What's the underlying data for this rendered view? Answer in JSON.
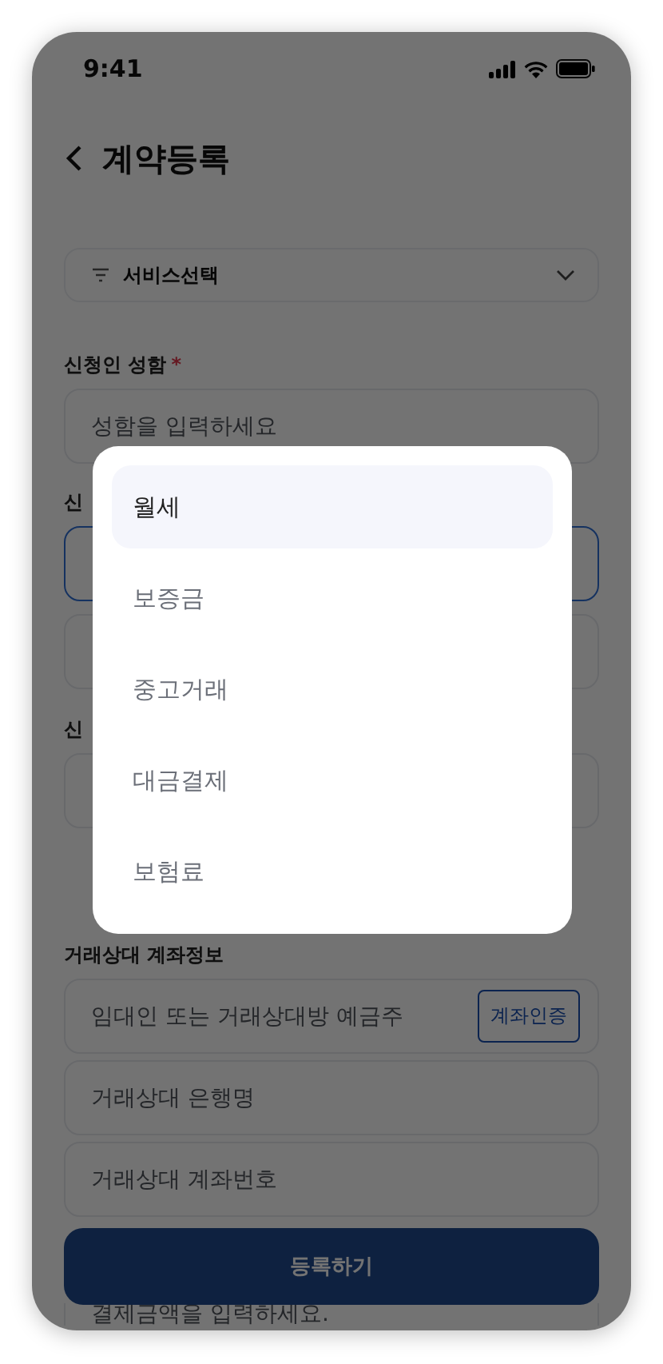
{
  "status_bar": {
    "time": "9:41"
  },
  "header": {
    "title": "계약등록"
  },
  "service_select": {
    "label": "서비스선택"
  },
  "sections": [
    {
      "label": "신청인 성함",
      "required_mark": "*",
      "fields": [
        {
          "placeholder": "성함을 입력하세요",
          "focused": false
        }
      ]
    },
    {
      "label": "신",
      "fields": [
        {
          "focused": true
        },
        {
          "focused": false
        }
      ]
    },
    {
      "label": "신",
      "fields": [
        {
          "focused": false
        }
      ]
    },
    {
      "label": "거래상대 계좌정보",
      "fields": [
        {
          "placeholder": "임대인 또는 거래상대방 예금주",
          "focused": false,
          "button": "계좌인증"
        },
        {
          "placeholder": "거래상대 은행명",
          "focused": false
        },
        {
          "placeholder": "거래상대 계좌번호",
          "focused": false
        },
        {
          "placeholder": "결제금액을 입력하세요.",
          "focused": false
        }
      ]
    }
  ],
  "submit_button": "등록하기",
  "options": [
    {
      "label": "월세",
      "selected": true
    },
    {
      "label": "보증금",
      "selected": false
    },
    {
      "label": "중고거래",
      "selected": false
    },
    {
      "label": "대금결제",
      "selected": false
    },
    {
      "label": "보험료",
      "selected": false
    }
  ]
}
